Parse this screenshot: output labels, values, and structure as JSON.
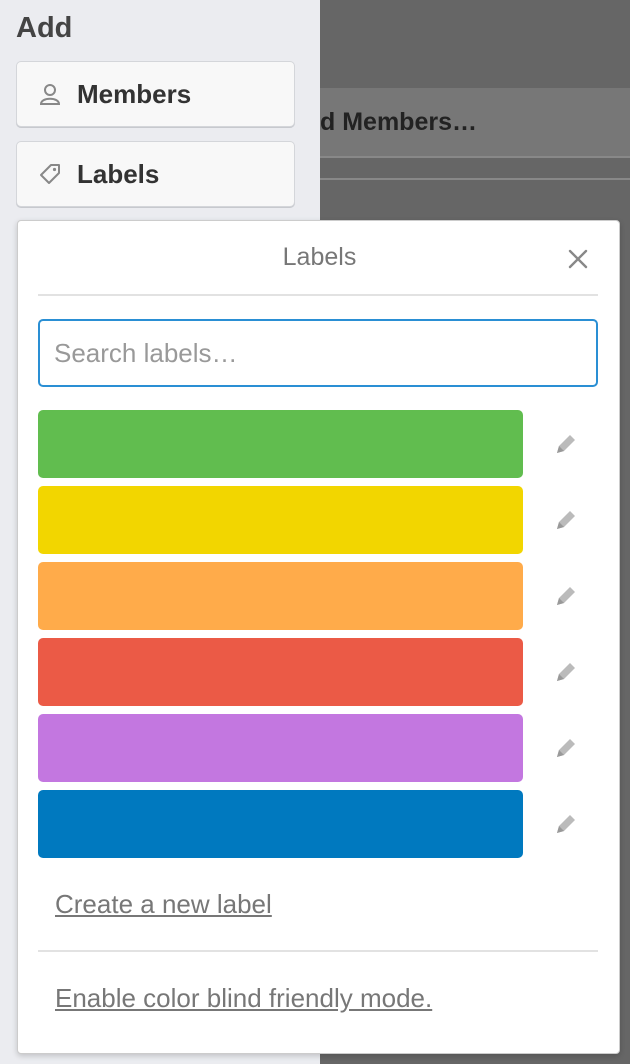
{
  "sidebar": {
    "title": "Add",
    "buttons": [
      {
        "label": "Members",
        "icon": "person-icon"
      },
      {
        "label": "Labels",
        "icon": "tag-icon"
      }
    ]
  },
  "background": {
    "card_title": "d Members…"
  },
  "popover": {
    "title": "Labels",
    "search": {
      "placeholder": "Search labels…",
      "value": ""
    },
    "labels": [
      {
        "color": "#61bd4f",
        "name": ""
      },
      {
        "color": "#f2d600",
        "name": ""
      },
      {
        "color": "#ffab4a",
        "name": ""
      },
      {
        "color": "#eb5a46",
        "name": ""
      },
      {
        "color": "#c377e0",
        "name": ""
      },
      {
        "color": "#0079bf",
        "name": ""
      }
    ],
    "create_link": "Create a new label",
    "colorblind_link": "Enable color blind friendly mode."
  }
}
